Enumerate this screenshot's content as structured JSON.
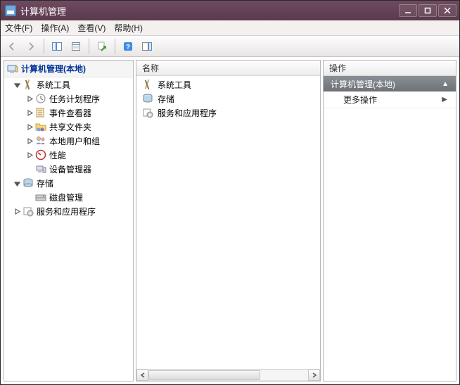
{
  "window": {
    "title": "计算机管理"
  },
  "menubar": {
    "file": "文件(F)",
    "action": "操作(A)",
    "view": "查看(V)",
    "help": "帮助(H)"
  },
  "columns": {
    "name": "名称"
  },
  "actions": {
    "panel_title": "操作",
    "header": "计算机管理(本地)",
    "more": "更多操作"
  },
  "tree": {
    "root": "计算机管理(本地)",
    "system_tools": "系统工具",
    "task_scheduler": "任务计划程序",
    "event_viewer": "事件查看器",
    "shared_folders": "共享文件夹",
    "local_users_groups": "本地用户和组",
    "performance": "性能",
    "device_manager": "设备管理器",
    "storage": "存储",
    "disk_management": "磁盘管理",
    "services_apps": "服务和应用程序"
  },
  "list": {
    "item0": "系统工具",
    "item1": "存储",
    "item2": "服务和应用程序"
  }
}
